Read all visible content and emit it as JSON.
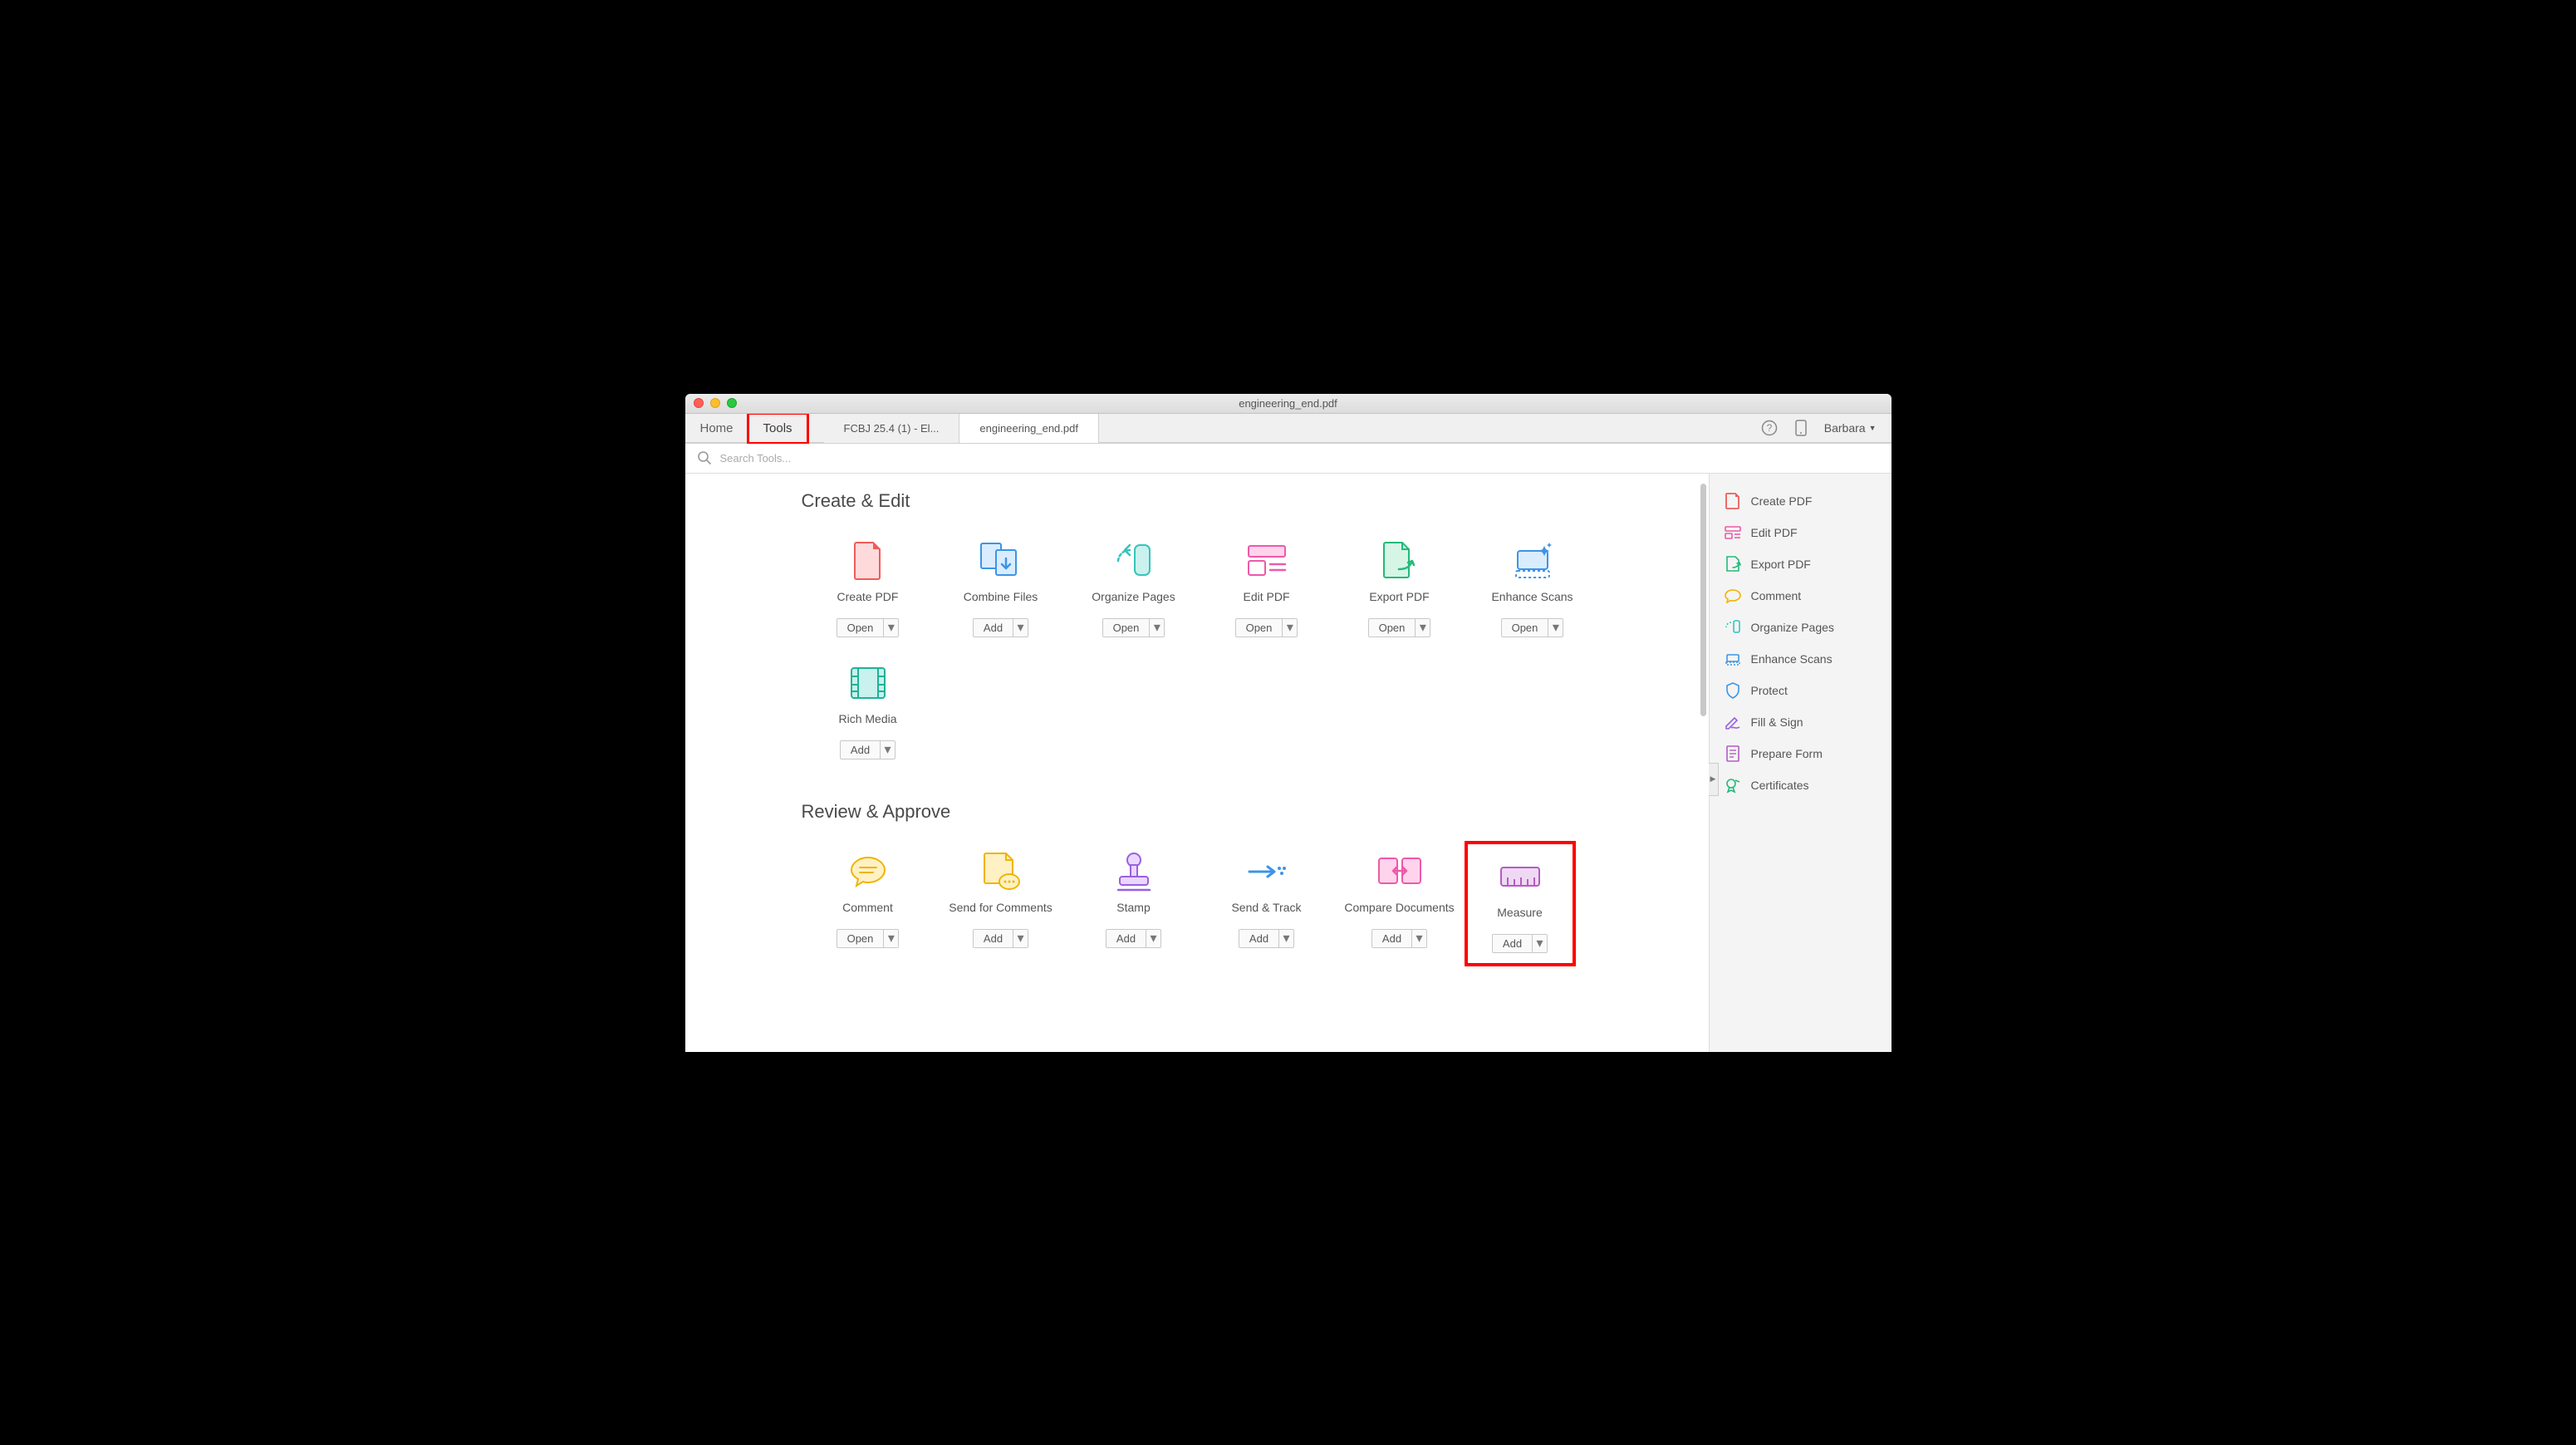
{
  "window": {
    "title": "engineering_end.pdf"
  },
  "nav": {
    "home": "Home",
    "tools": "Tools"
  },
  "tabs": [
    {
      "label": "FCBJ 25.4 (1) - El..."
    },
    {
      "label": "engineering_end.pdf"
    }
  ],
  "user": {
    "name": "Barbara"
  },
  "search": {
    "placeholder": "Search Tools..."
  },
  "sections": {
    "create_edit": {
      "title": "Create & Edit",
      "tools": [
        {
          "label": "Create PDF",
          "action": "Open"
        },
        {
          "label": "Combine Files",
          "action": "Add"
        },
        {
          "label": "Organize Pages",
          "action": "Open"
        },
        {
          "label": "Edit PDF",
          "action": "Open"
        },
        {
          "label": "Export PDF",
          "action": "Open"
        },
        {
          "label": "Enhance Scans",
          "action": "Open"
        },
        {
          "label": "Rich Media",
          "action": "Add"
        }
      ]
    },
    "review_approve": {
      "title": "Review & Approve",
      "tools": [
        {
          "label": "Comment",
          "action": "Open"
        },
        {
          "label": "Send for Comments",
          "action": "Add"
        },
        {
          "label": "Stamp",
          "action": "Add"
        },
        {
          "label": "Send & Track",
          "action": "Add"
        },
        {
          "label": "Compare Documents",
          "action": "Add"
        },
        {
          "label": "Measure",
          "action": "Add"
        }
      ]
    }
  },
  "sidebar": [
    {
      "label": "Create PDF"
    },
    {
      "label": "Edit PDF"
    },
    {
      "label": "Export PDF"
    },
    {
      "label": "Comment"
    },
    {
      "label": "Organize Pages"
    },
    {
      "label": "Enhance Scans"
    },
    {
      "label": "Protect"
    },
    {
      "label": "Fill & Sign"
    },
    {
      "label": "Prepare Form"
    },
    {
      "label": "Certificates"
    }
  ]
}
